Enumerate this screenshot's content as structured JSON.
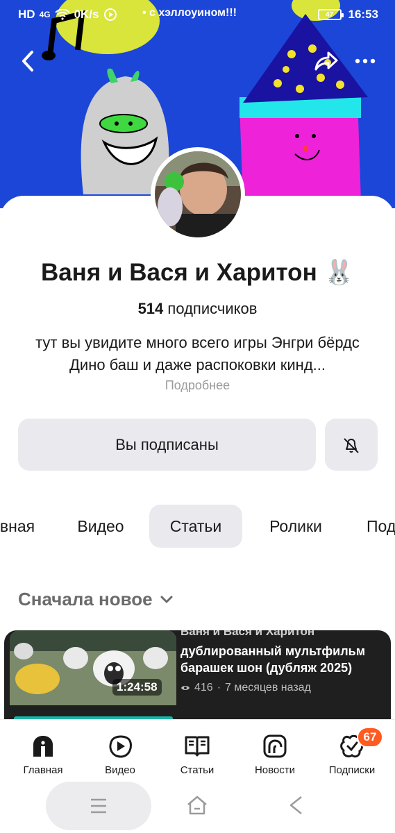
{
  "status_bar": {
    "network": "HD",
    "network_gen": "4G",
    "speed": "0K/s",
    "notification": "с хэллоуином!!!",
    "battery": "47",
    "time": "16:53"
  },
  "channel": {
    "name": "Ваня и Вася и Харитон",
    "name_emoji": "🐰",
    "subscribers_count": "514",
    "subscribers_label": "подписчиков",
    "description": "тут вы увидите много всего игры  Энгри бёрдс Дино баш и даже распоковки кинд...",
    "more_link": "Подробнее"
  },
  "actions": {
    "subscribed_label": "Вы подписаны"
  },
  "tabs": [
    {
      "label": "вная",
      "active": false
    },
    {
      "label": "Видео",
      "active": false
    },
    {
      "label": "Статьи",
      "active": true
    },
    {
      "label": "Ролики",
      "active": false
    },
    {
      "label": "Под",
      "active": false
    }
  ],
  "sort": {
    "label": "Сначала новое"
  },
  "video": {
    "channel": "Ваня и Вася и Харитон",
    "title": "дублированный мультфильм барашек шон (дубляж 2025)",
    "duration": "1:24:58",
    "views": "416",
    "age": "7 месяцев назад",
    "progress": 0.98
  },
  "bottom_nav": [
    {
      "label": "Главная",
      "icon": "home-icon"
    },
    {
      "label": "Видео",
      "icon": "video-play-icon"
    },
    {
      "label": "Статьи",
      "icon": "book-icon"
    },
    {
      "label": "Новости",
      "icon": "news-icon"
    },
    {
      "label": "Подписки",
      "icon": "subscriptions-icon",
      "badge": "67"
    }
  ],
  "colors": {
    "banner_bg": "#1c46d8",
    "badge": "#ff5a1f",
    "button_bg": "#e9e9ee",
    "progress": "#1bb3a6"
  }
}
